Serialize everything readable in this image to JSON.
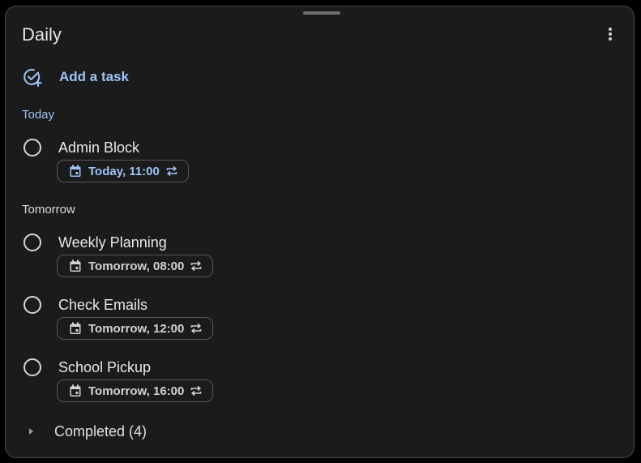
{
  "list": {
    "title": "Daily",
    "menu_icon": "more-vert-icon"
  },
  "add_task": {
    "label": "Add a task",
    "icon": "add-task-icon"
  },
  "sections": {
    "today": {
      "label": "Today",
      "tasks": [
        {
          "title": "Admin Block",
          "due": "Today, 11:00",
          "repeating": true
        }
      ]
    },
    "tomorrow": {
      "label": "Tomorrow",
      "tasks": [
        {
          "title": "Weekly Planning",
          "due": "Tomorrow, 08:00",
          "repeating": true
        },
        {
          "title": "Check Emails",
          "due": "Tomorrow, 12:00",
          "repeating": true
        },
        {
          "title": "School Pickup",
          "due": "Tomorrow, 16:00",
          "repeating": true
        }
      ]
    }
  },
  "completed": {
    "label": "Completed (4)"
  },
  "colors": {
    "accent": "#9ec3f7",
    "background": "#1b1b1b",
    "border": "#4a4a4a",
    "text": "#e8e8e8"
  }
}
